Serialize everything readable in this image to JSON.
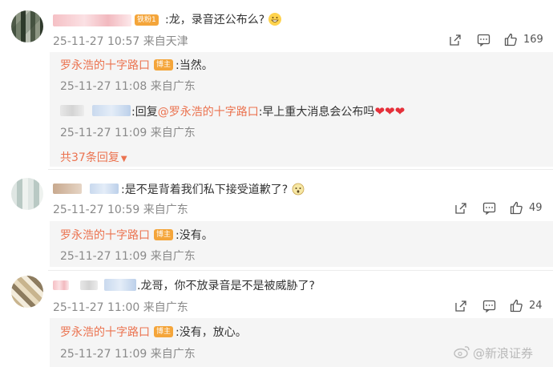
{
  "comments": [
    {
      "text": ":龙，录音还公布么?",
      "meta": "25-11-27 10:57 来自天津",
      "badge": "铁粉1",
      "likes": "169",
      "replies": [
        {
          "name": "罗永浩的十字路口",
          "badge": "博主",
          "text": ":当然。",
          "meta": "25-11-27 11:08 来自广东"
        },
        {
          "prefix": ":回复",
          "mention": "@罗永浩的十字路口",
          "text": ":早上重大消息会公布吗",
          "hearts": "❤❤❤",
          "meta": "25-11-27 11:09 来自广东"
        }
      ],
      "more": "共37条回复"
    },
    {
      "text": ":是不是背着我们私下接受道歉了?",
      "meta": "25-11-27 10:59 来自广东",
      "likes": "49",
      "replies": [
        {
          "name": "罗永浩的十字路口",
          "badge": "博主",
          "text": ":没有。",
          "meta": "25-11-27 11:09 来自广东"
        }
      ]
    },
    {
      "text": ".龙哥，你不放录音是不是被威胁了?",
      "meta": "25-11-27 11:00 来自广东",
      "likes": "24",
      "replies": [
        {
          "name": "罗永浩的十字路口",
          "badge": "博主",
          "text": ":没有，放心。",
          "meta": "25-11-27 11:09 来自广东"
        }
      ]
    }
  ],
  "watermark": "@新浪证券"
}
